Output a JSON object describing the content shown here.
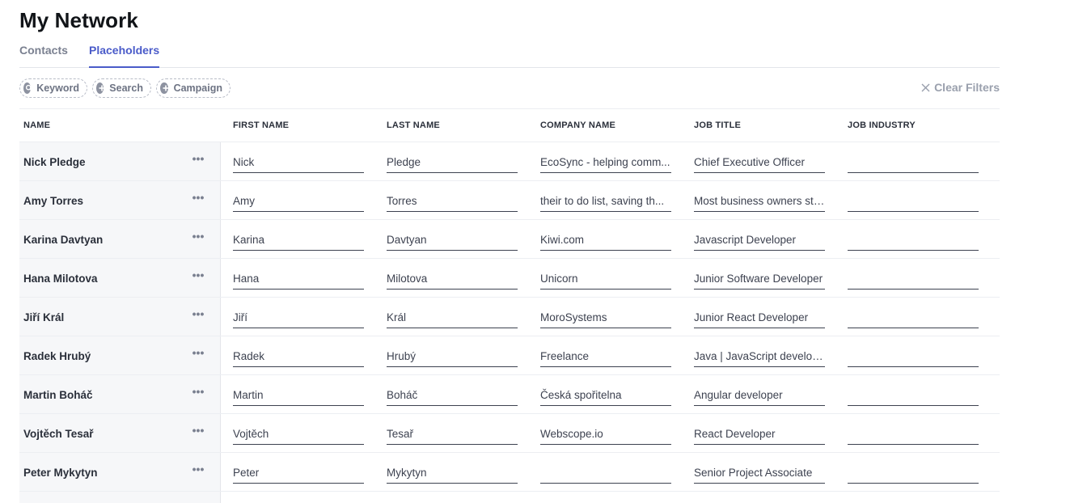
{
  "header": {
    "title": "My Network"
  },
  "tabs": [
    {
      "label": "Contacts"
    },
    {
      "label": "Placeholders"
    }
  ],
  "filters": {
    "chips": [
      {
        "label": "Keyword",
        "icon": "search-icon"
      },
      {
        "label": "Search",
        "icon": "plus-icon"
      },
      {
        "label": "Campaign",
        "icon": "plus-icon"
      }
    ],
    "clear_label": "Clear Filters"
  },
  "table": {
    "columns": [
      "NAME",
      "FIRST NAME",
      "LAST NAME",
      "COMPANY NAME",
      "JOB TITLE",
      "JOB INDUSTRY"
    ],
    "rows": [
      {
        "name": "Nick Pledge",
        "first": "Nick",
        "last": "Pledge",
        "company": "EcoSync - helping comm...",
        "title": "Chief Executive Officer",
        "industry": ""
      },
      {
        "name": "Amy Torres",
        "first": "Amy",
        "last": "Torres",
        "company": "their to do list, saving th...",
        "title": "Most business owners str...",
        "industry": ""
      },
      {
        "name": "Karina Davtyan",
        "first": "Karina",
        "last": "Davtyan",
        "company": "Kiwi.com",
        "title": "Javascript Developer",
        "industry": ""
      },
      {
        "name": "Hana Milotova",
        "first": "Hana",
        "last": "Milotova",
        "company": "Unicorn",
        "title": "Junior Software Developer",
        "industry": ""
      },
      {
        "name": "Jiří Král",
        "first": "Jiří",
        "last": "Král",
        "company": "MoroSystems",
        "title": "Junior React Developer",
        "industry": ""
      },
      {
        "name": "Radek Hrubý",
        "first": "Radek",
        "last": "Hrubý",
        "company": "Freelance",
        "title": "Java | JavaScript developer",
        "industry": ""
      },
      {
        "name": "Martin Boháč",
        "first": "Martin",
        "last": "Boháč",
        "company": "Česká spořitelna",
        "title": "Angular developer",
        "industry": ""
      },
      {
        "name": "Vojtěch Tesař",
        "first": "Vojtěch",
        "last": "Tesař",
        "company": "Webscope.io",
        "title": "React Developer",
        "industry": ""
      },
      {
        "name": "Peter Mykytyn",
        "first": "Peter",
        "last": "Mykytyn",
        "company": "",
        "title": "Senior Project Associate",
        "industry": ""
      }
    ]
  },
  "colors": {
    "accent": "#4a5bc9",
    "text": "#2a2f3a",
    "muted": "#7a8090",
    "name_cell_bg": "#f6f7f9"
  }
}
